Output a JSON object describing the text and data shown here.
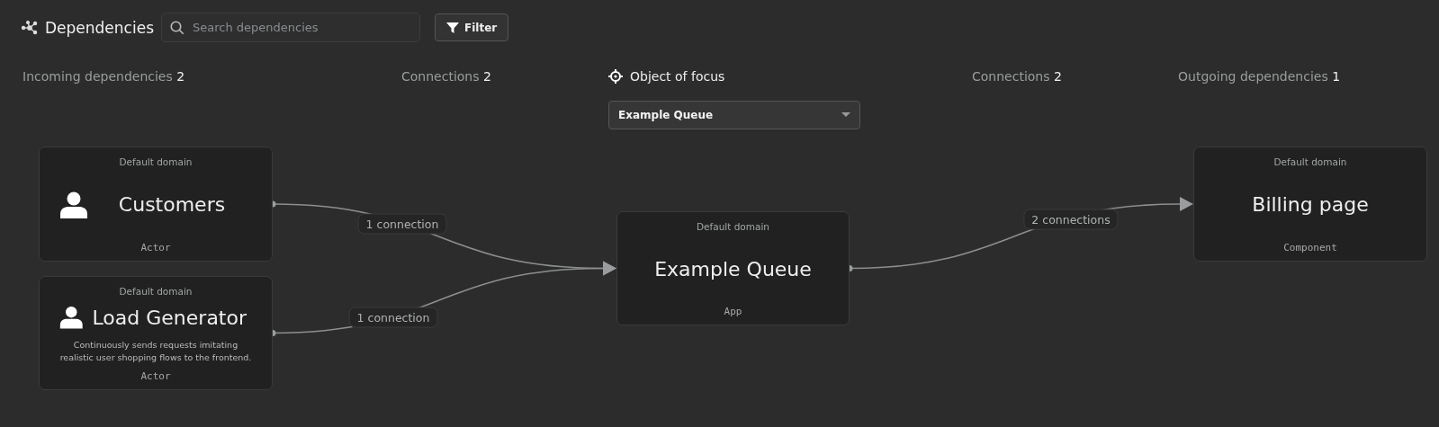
{
  "header": {
    "title": "Dependencies",
    "search": {
      "placeholder": "Search dependencies"
    },
    "filter_button": "Filter"
  },
  "columns": [
    {
      "kind": "count",
      "label": "Incoming dependencies",
      "count": "2"
    },
    {
      "kind": "count",
      "label": "Connections",
      "count": "2"
    },
    {
      "kind": "focus",
      "label": "Object of focus",
      "value": "Example Queue"
    },
    {
      "kind": "count",
      "label": "Connections",
      "count": "2"
    },
    {
      "kind": "count",
      "label": "Outgoing dependencies",
      "count": "1"
    }
  ],
  "nodes": [
    {
      "kind": "actor",
      "domain": "Default domain",
      "name": "Customers",
      "type": "Actor"
    },
    {
      "kind": "actor",
      "domain": "Default domain",
      "name": "Load Generator",
      "description": "Continuously sends requests imitating realistic user shopping flows to the frontend.",
      "type": "Actor"
    },
    {
      "kind": "plain",
      "domain": "Default domain",
      "name": "Example Queue",
      "type": "App"
    },
    {
      "kind": "plain",
      "domain": "Default domain",
      "name": "Billing page",
      "type": "Component"
    }
  ],
  "edges": [
    {
      "label": "1 connection"
    },
    {
      "label": "1 connection"
    },
    {
      "label": "2 connections"
    }
  ]
}
